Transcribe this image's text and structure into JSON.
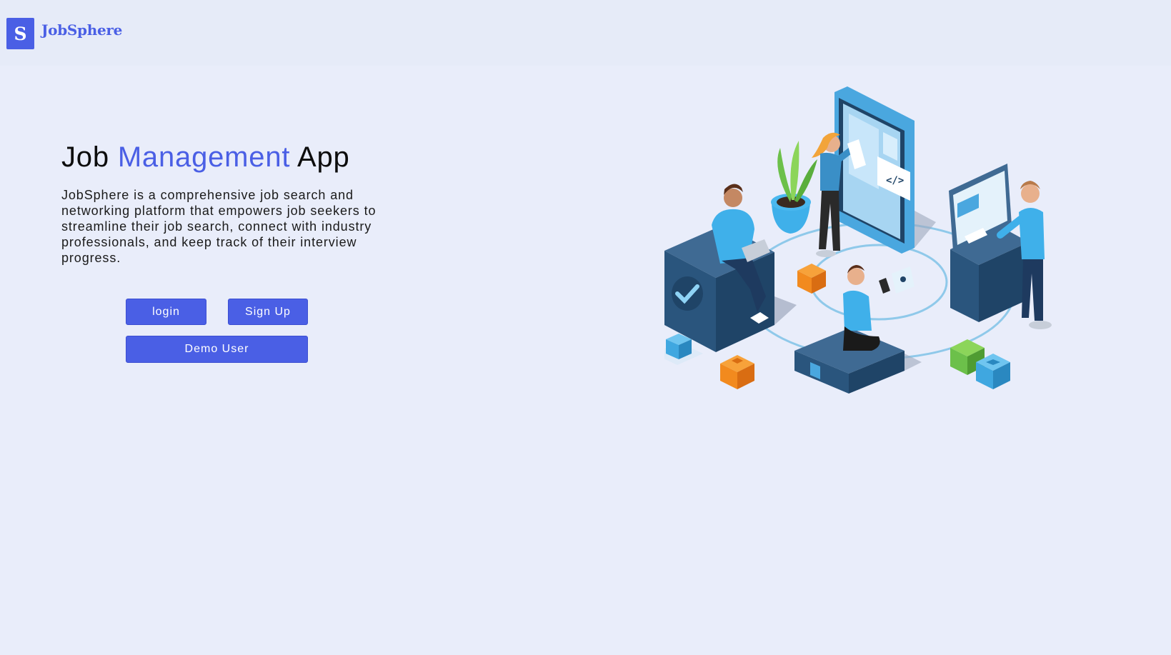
{
  "brand": {
    "logo_letter": "S",
    "name": "JobSphere"
  },
  "hero": {
    "title_part1": "Job ",
    "title_accent": "Management",
    "title_part2": " App",
    "description": "JobSphere is a comprehensive job search and networking platform that empowers job seekers to streamline their job search, connect with industry professionals, and keep track of their interview progress."
  },
  "buttons": {
    "login": "login",
    "signup": "Sign Up",
    "demo": "Demo User"
  },
  "illustration": {
    "icon": "isometric-team-collaboration-illustration",
    "code_tag": "</>"
  },
  "colors": {
    "accent": "#4a5fe5",
    "background": "#e9edfa",
    "navbar": "#e6ebf8"
  }
}
